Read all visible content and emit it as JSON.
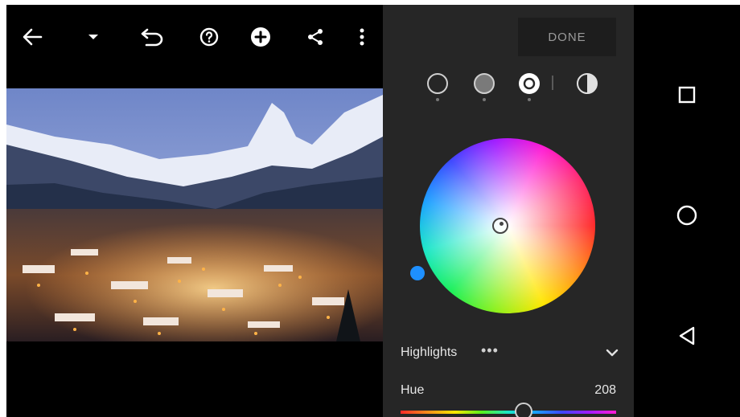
{
  "toolbar": {
    "icons": [
      "back-arrow-icon",
      "dropdown-caret-icon",
      "undo-icon",
      "help-icon",
      "add-icon",
      "share-icon",
      "more-vert-icon"
    ]
  },
  "panel": {
    "done_label": "DONE",
    "modes": [
      "shadows-mode",
      "midtones-mode",
      "highlights-mode",
      "global-mode"
    ],
    "selected_mode": "highlights-mode",
    "section_label": "Highlights",
    "more_label": "•••",
    "hue_label": "Hue",
    "hue_value": "208",
    "hue_fraction": 0.57
  },
  "navbar": {
    "icons": [
      "recents-square-icon",
      "home-circle-icon",
      "back-triangle-icon"
    ]
  },
  "colors": {
    "panel_bg": "#262626",
    "accent_blue": "#1e90ff"
  }
}
